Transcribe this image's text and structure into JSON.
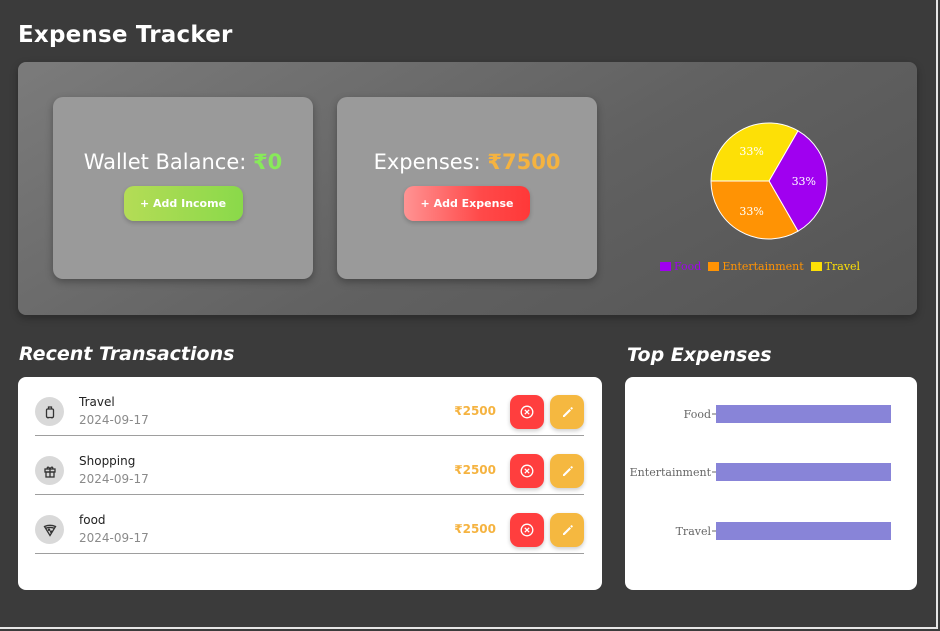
{
  "app": {
    "title": "Expense Tracker"
  },
  "wallet": {
    "label": "Wallet Balance: ",
    "amount": "₹0",
    "button_label": "+ Add Income"
  },
  "expenses": {
    "label": "Expenses: ",
    "amount": "₹7500",
    "button_label": "+ Add Expense"
  },
  "pie": {
    "slices": [
      {
        "name": "Food",
        "percent": 33.33,
        "label": "33%",
        "color": "#a000f0"
      },
      {
        "name": "Entertainment",
        "percent": 33.33,
        "label": "33%",
        "color": "#ff9304"
      },
      {
        "name": "Travel",
        "percent": 33.33,
        "label": "33%",
        "color": "#fde006"
      }
    ]
  },
  "recent": {
    "title": "Recent Transactions",
    "items": [
      {
        "name": "Travel",
        "date": "2024-09-17",
        "amount": "₹2500",
        "icon": "luggage-icon"
      },
      {
        "name": "Shopping",
        "date": "2024-09-17",
        "amount": "₹2500",
        "icon": "gift-icon"
      },
      {
        "name": "food",
        "date": "2024-09-17",
        "amount": "₹2500",
        "icon": "pizza-icon"
      }
    ]
  },
  "top_expenses": {
    "title": "Top Expenses",
    "bar_color": "#8884d8",
    "categories": [
      "Food",
      "Entertainment",
      "Travel"
    ],
    "values": [
      2500,
      2500,
      2500
    ]
  }
}
